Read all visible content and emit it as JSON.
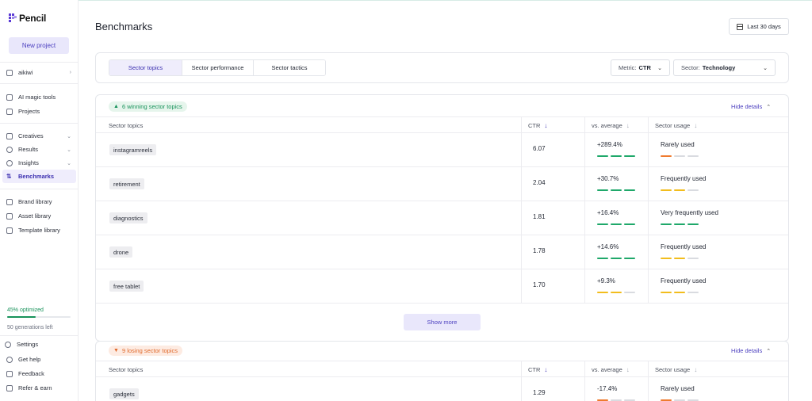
{
  "colors": {
    "accent": "#4b3fbf",
    "accent_soft": "#e9e7fb",
    "green": "#1fa86a",
    "yellow": "#f2bd1d",
    "orange": "#ef7b2f",
    "gray_segment": "#d9dbe0"
  },
  "sidebar": {
    "brand": "Pencil",
    "new_project": "New project",
    "workspace": "aikiwi",
    "items": [
      {
        "label": "AI magic tools",
        "icon": "magic-wand-icon"
      },
      {
        "label": "Projects",
        "icon": "folder-icon"
      },
      {
        "label": "Creatives",
        "icon": "image-icon"
      },
      {
        "label": "Results",
        "icon": "gauge-icon"
      },
      {
        "label": "Insights",
        "icon": "lightbulb-icon"
      },
      {
        "label": "Benchmarks",
        "icon": "sort-arrows-icon"
      },
      {
        "label": "Brand library",
        "icon": "book-icon"
      },
      {
        "label": "Asset library",
        "icon": "image-stack-icon"
      },
      {
        "label": "Template library",
        "icon": "template-icon"
      }
    ],
    "optimized_label": "45% optimized",
    "optimized_fraction": 0.45,
    "generations_left": "50 generations left",
    "bottom": [
      {
        "label": "Settings",
        "icon": "gear-icon"
      },
      {
        "label": "Get help",
        "icon": "help-icon"
      },
      {
        "label": "Feedback",
        "icon": "chat-icon"
      },
      {
        "label": "Refer & earn",
        "icon": "gift-icon"
      }
    ]
  },
  "header": {
    "title": "Benchmarks",
    "date_range": "Last 30 days"
  },
  "tabs": [
    {
      "label": "Sector topics",
      "active": true
    },
    {
      "label": "Sector performance",
      "active": false
    },
    {
      "label": "Sector tactics",
      "active": false
    }
  ],
  "filters": {
    "metric_label": "Metric:",
    "metric_value": "CTR",
    "sector_label": "Sector:",
    "sector_value": "Technology"
  },
  "columns": {
    "topic": "Sector topics",
    "ctr": "CTR",
    "vs": "vs. average",
    "usage": "Sector usage"
  },
  "winning": {
    "badge": "6 winning sector topics",
    "toggle": "Hide details",
    "rows": [
      {
        "topic": "instagramreels",
        "ctr": "6.07",
        "vs": "+289.4%",
        "vs_level": 3,
        "usage": "Rarely used",
        "usage_level": 1,
        "usage_color": "orange"
      },
      {
        "topic": "retirement",
        "ctr": "2.04",
        "vs": "+30.7%",
        "vs_level": 3,
        "usage": "Frequently used",
        "usage_level": 2,
        "usage_color": "yellow"
      },
      {
        "topic": "diagnostics",
        "ctr": "1.81",
        "vs": "+16.4%",
        "vs_level": 3,
        "usage": "Very frequently used",
        "usage_level": 3,
        "usage_color": "green"
      },
      {
        "topic": "drone",
        "ctr": "1.78",
        "vs": "+14.6%",
        "vs_level": 3,
        "usage": "Frequently used",
        "usage_level": 2,
        "usage_color": "yellow"
      },
      {
        "topic": "free tablet",
        "ctr": "1.70",
        "vs": "+9.3%",
        "vs_level": 2,
        "usage": "Frequently used",
        "usage_level": 2,
        "usage_color": "yellow"
      }
    ],
    "show_more": "Show more"
  },
  "losing": {
    "badge": "9 losing sector topics",
    "toggle": "Hide details",
    "rows": [
      {
        "topic": "gadgets",
        "ctr": "1.29",
        "vs": "-17.4%",
        "vs_level": 1,
        "usage": "Rarely used",
        "usage_level": 1,
        "usage_color": "orange"
      }
    ]
  }
}
